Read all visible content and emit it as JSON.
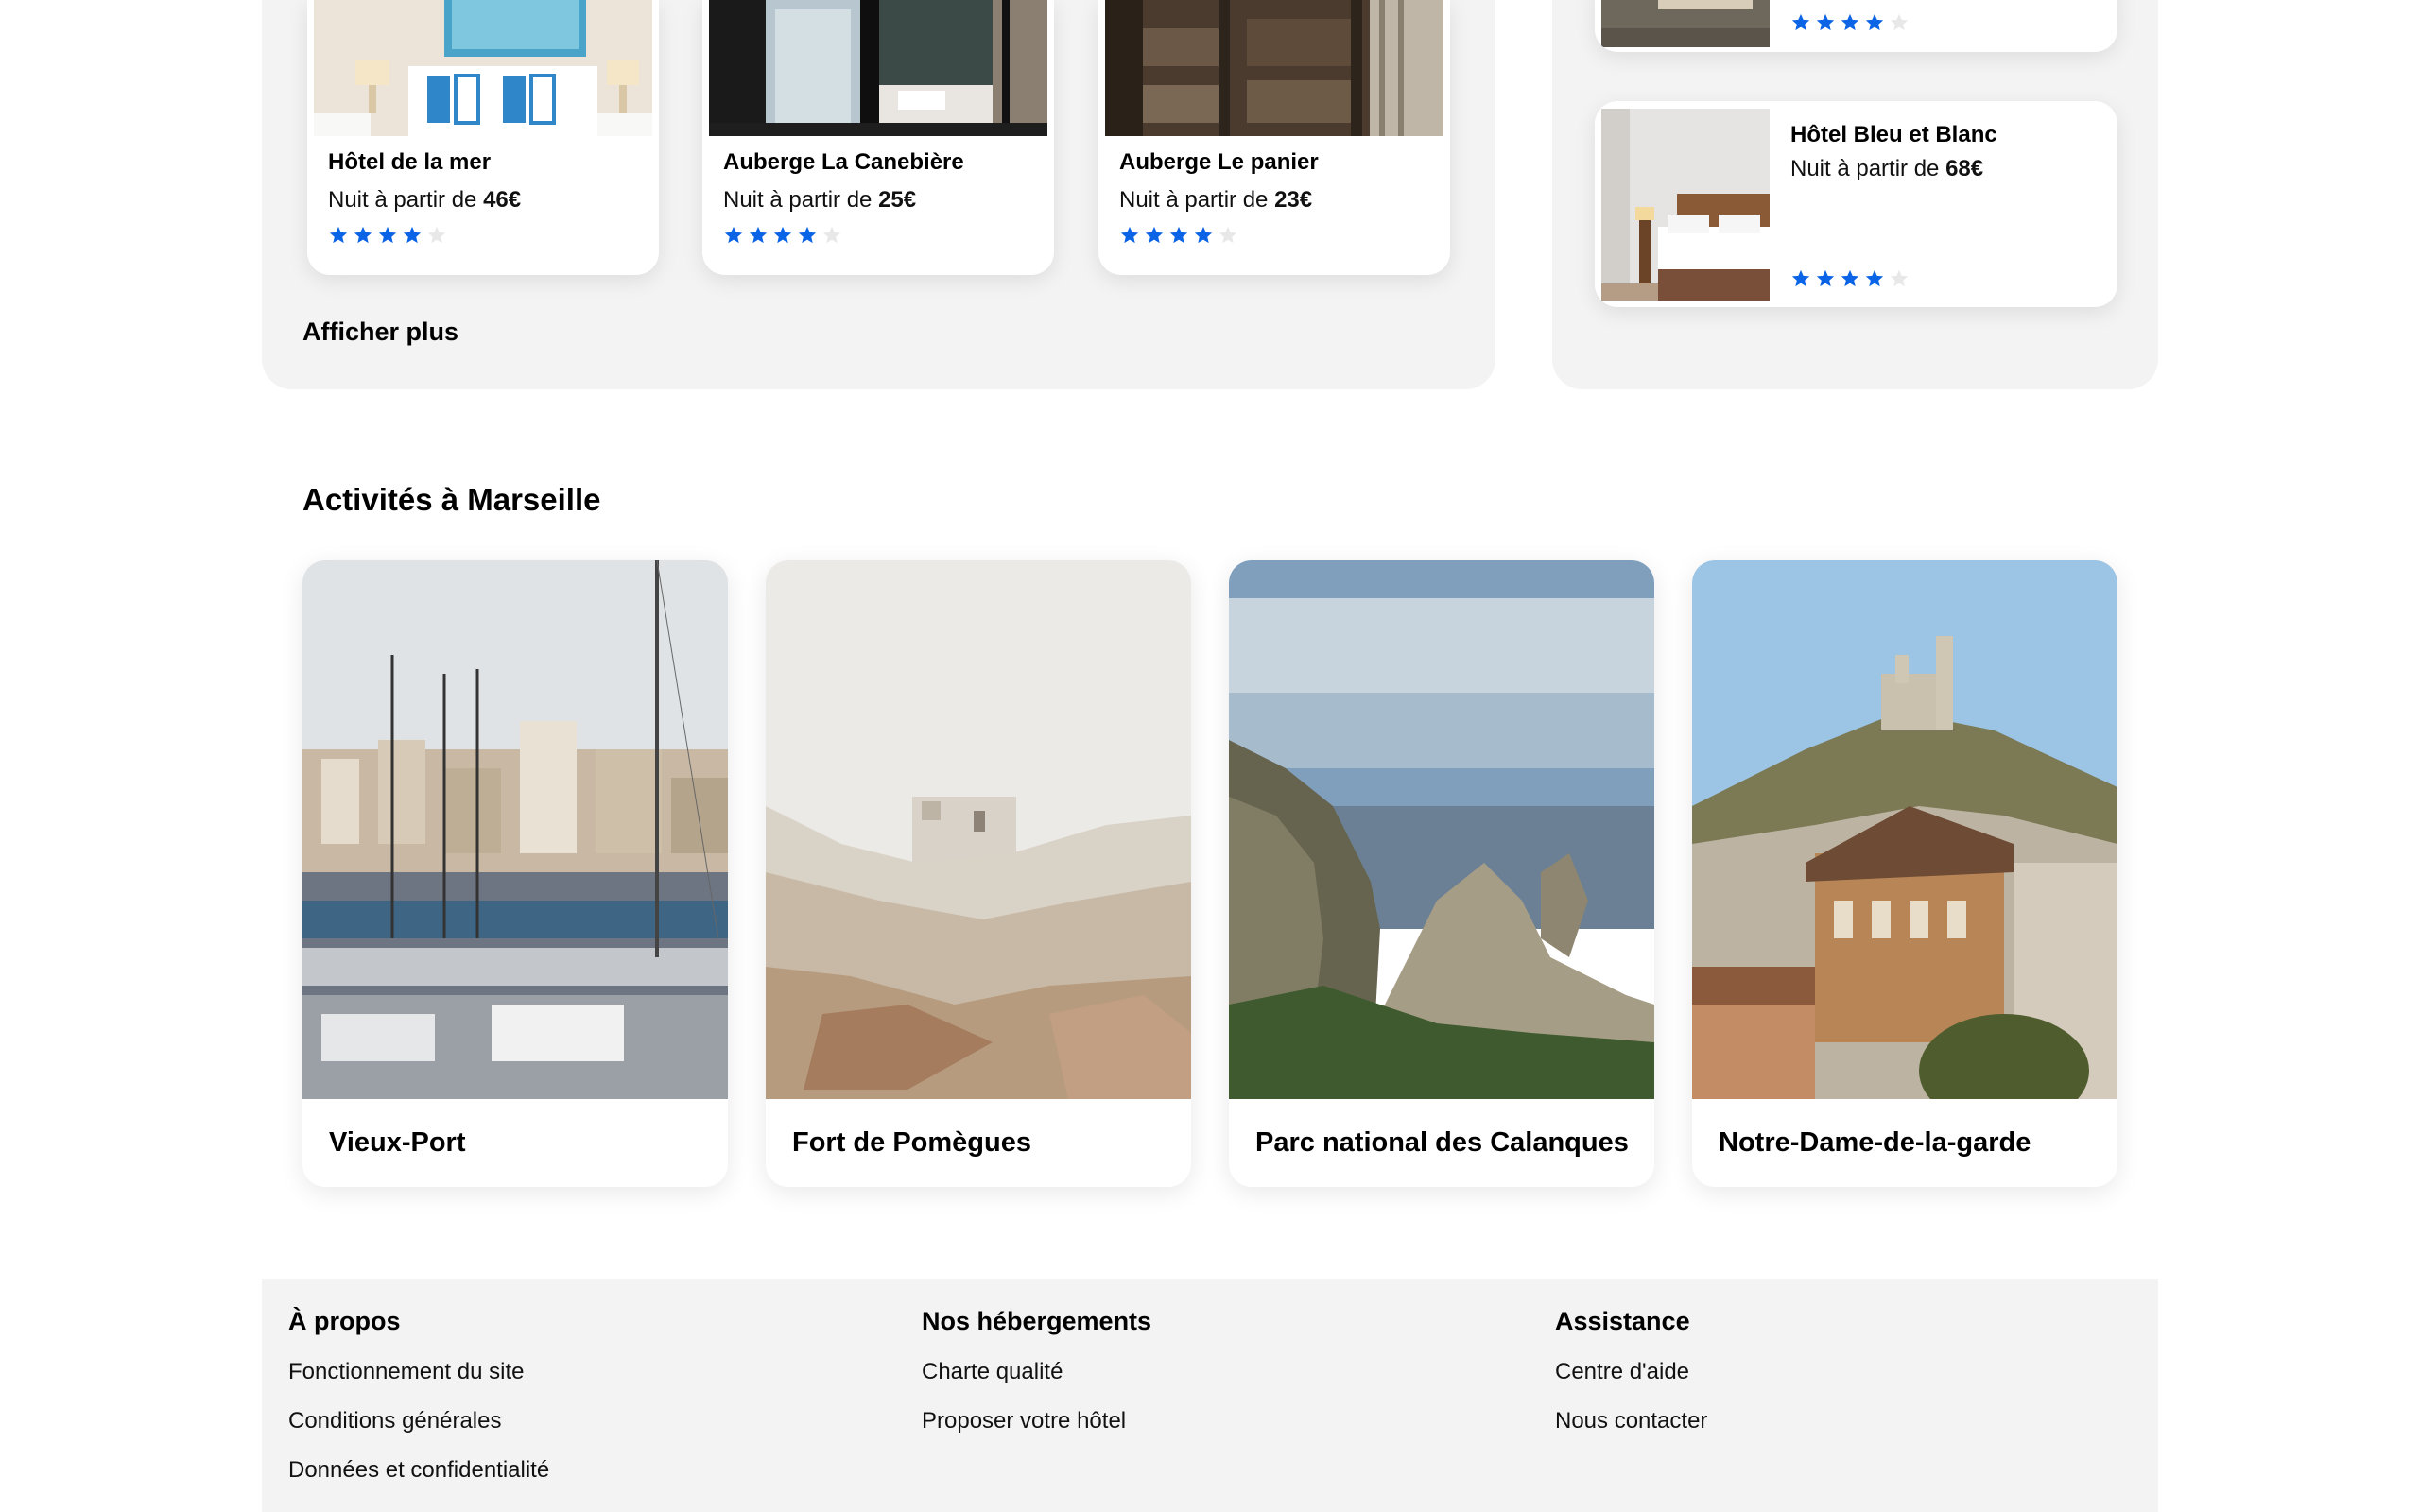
{
  "hotels": [
    {
      "name": "Hôtel de la mer",
      "price_prefix": "Nuit à partir de ",
      "price": "46€",
      "rating": 4
    },
    {
      "name": "Auberge La Canebière",
      "price_prefix": "Nuit à partir de ",
      "price": "25€",
      "rating": 4
    },
    {
      "name": "Auberge Le panier",
      "price_prefix": "Nuit à partir de ",
      "price": "23€",
      "rating": 4
    }
  ],
  "show_more": "Afficher plus",
  "side_hotels": [
    {
      "name": "",
      "rating": 4
    },
    {
      "name": "Hôtel Bleu et Blanc",
      "price_prefix": "Nuit à partir de ",
      "price": "68€",
      "rating": 4
    }
  ],
  "activities_title": "Activités à Marseille",
  "activities": [
    {
      "label": "Vieux-Port"
    },
    {
      "label": "Fort de Pomègues"
    },
    {
      "label": "Parc national des Calanques"
    },
    {
      "label": "Notre-Dame-de-la-garde"
    }
  ],
  "footer": {
    "about": {
      "title": "À propos",
      "links": [
        "Fonctionnement du site",
        "Conditions générales",
        "Données et confidentialité"
      ]
    },
    "lodging": {
      "title": "Nos hébergements",
      "links": [
        "Charte qualité",
        "Proposer votre hôtel"
      ]
    },
    "help": {
      "title": "Assistance",
      "links": [
        "Centre d'aide",
        "Nous contacter"
      ]
    }
  },
  "colors": {
    "accent": "#0b63e5",
    "star_empty": "#e8e8e8",
    "panel_bg": "#f3f3f4"
  }
}
